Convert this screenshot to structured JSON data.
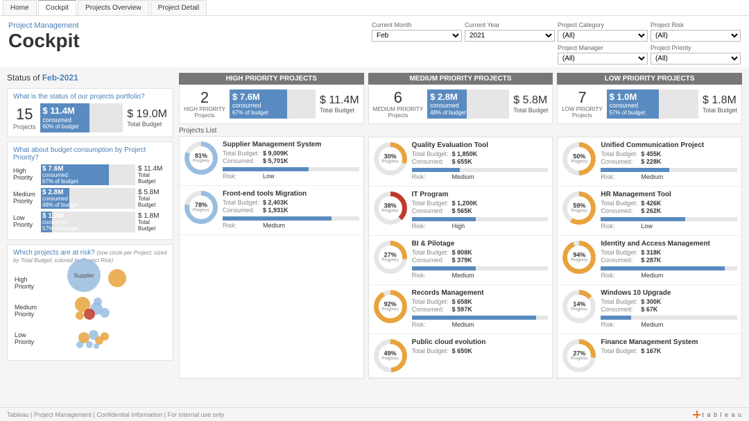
{
  "tabs": [
    "Home",
    "Cockpit",
    "Projects Overview",
    "Project Detail"
  ],
  "active_tab": 1,
  "header": {
    "sub": "Project Management",
    "main": "Cockpit"
  },
  "filters": [
    {
      "label": "Current Month",
      "value": "Feb"
    },
    {
      "label": "Current Year",
      "value": "2021"
    },
    {
      "label": "Project Category",
      "value": "(All)"
    },
    {
      "label": "Project Risk",
      "value": "(All)"
    },
    {
      "label": "Project Manager",
      "value": "(All)",
      "col": 2
    },
    {
      "label": "Project Priority",
      "value": "(All)",
      "col": 3
    }
  ],
  "status_prefix": "Status of",
  "status_date": "Feb-2021",
  "portfolio": {
    "q": "What is the status of our projects portfolio?",
    "count": "15",
    "count_label": "Projects",
    "consumed": "$ 11.4M",
    "consumed_label": "consumed",
    "pct": "60%",
    "pct_label": "of budget",
    "fill": 60,
    "total": "$ 19.0M",
    "total_label": "Total Budget"
  },
  "by_priority": {
    "q": "What about budget consumption by Project Priority?",
    "rows": [
      {
        "label": "High Priority",
        "amt": "$ 7.6M",
        "pct": "67%",
        "fill": 72,
        "total_amt": "$ 11.4M"
      },
      {
        "label": "Medium Priority",
        "amt": "$ 2.8M",
        "pct": "48%",
        "fill": 30,
        "total_amt": "$ 5.8M"
      },
      {
        "label": "Low Priority",
        "amt": "$ 1.0M",
        "pct": "57%",
        "fill": 12,
        "total_amt": "$ 1.8M"
      }
    ],
    "total_label": "Total Budget",
    "consumed_label": "consumed",
    "of_label": "of budget"
  },
  "risk": {
    "q": "Which projects are at risk?",
    "note": "(one circle per Project: sized by Total Budget, colored by Project Risk)",
    "rows": [
      "High Priority",
      "Medium Priority",
      "Low Priority"
    ],
    "supplier_label": "Supplier"
  },
  "columns": [
    {
      "title": "HIGH PRIORITY PROJECTS",
      "count": "2",
      "count_label": "HIGH PRIORITY Projects",
      "consumed": "$ 7.6M",
      "pct": "67%",
      "fill": 67,
      "total": "$ 11.4M",
      "list_title": "Projects List",
      "projects": [
        {
          "name": "Supplier Management System",
          "budget": "$ 9,009K",
          "consumed": "$ 5,701K",
          "progress": 81,
          "bar": 63,
          "risk": "Low",
          "color": "#99bde0"
        },
        {
          "name": "Front-end tools Migration",
          "budget": "$ 2,403K",
          "consumed": "$ 1,931K",
          "progress": 78,
          "bar": 80,
          "risk": "Medium",
          "color": "#99bde0"
        }
      ]
    },
    {
      "title": "MEDIUM PRIORITY PROJECTS",
      "count": "6",
      "count_label": "MEDIUM PRIORITY Projects",
      "consumed": "$ 2.8M",
      "pct": "48%",
      "fill": 48,
      "total": "$ 5.8M",
      "projects": [
        {
          "name": "Quality Evaluation Tool",
          "budget": "$ 1,850K",
          "consumed": "$ 655K",
          "progress": 30,
          "bar": 35,
          "risk": "Medium",
          "color": "#e8a33d"
        },
        {
          "name": "IT Program",
          "budget": "$ 1,200K",
          "consumed": "$ 565K",
          "progress": 38,
          "bar": 47,
          "risk": "High",
          "color": "#c0392b"
        },
        {
          "name": "BI & Pilotage",
          "budget": "$ 808K",
          "consumed": "$ 379K",
          "progress": 27,
          "bar": 47,
          "risk": "Medium",
          "color": "#e8a33d"
        },
        {
          "name": "Records Management",
          "budget": "$ 658K",
          "consumed": "$ 597K",
          "progress": 92,
          "bar": 91,
          "risk": "Medium",
          "color": "#e8a33d"
        },
        {
          "name": "Public cloud evolution",
          "budget": "$ 650K",
          "consumed": "",
          "progress": 49,
          "bar": 0,
          "risk": "",
          "color": "#e8a33d"
        }
      ]
    },
    {
      "title": "LOW PRIORITY PROJECTS",
      "count": "7",
      "count_label": "LOW PRIORITY Projects",
      "consumed": "$ 1.0M",
      "pct": "57%",
      "fill": 57,
      "total": "$ 1.8M",
      "projects": [
        {
          "name": "Unified Communication Project",
          "budget": "$ 455K",
          "consumed": "$ 228K",
          "progress": 50,
          "bar": 50,
          "risk": "Medium",
          "color": "#e8a33d"
        },
        {
          "name": "HR Management Tool",
          "budget": "$ 426K",
          "consumed": "$ 262K",
          "progress": 59,
          "bar": 62,
          "risk": "Low",
          "color": "#e8a33d"
        },
        {
          "name": "Identity and Access Management",
          "budget": "$ 318K",
          "consumed": "$ 287K",
          "progress": 94,
          "bar": 91,
          "risk": "Medium",
          "color": "#e8a33d"
        },
        {
          "name": "Windows 10 Upgrade",
          "budget": "$ 300K",
          "consumed": "$ 67K",
          "progress": 14,
          "bar": 22,
          "risk": "Medium",
          "color": "#e8a33d"
        },
        {
          "name": "Finance Management System",
          "budget": "$ 167K",
          "consumed": "",
          "progress": 27,
          "bar": 0,
          "risk": "",
          "color": "#e8a33d"
        }
      ]
    }
  ],
  "labels": {
    "total_budget": "Total Budget",
    "consumed": "consumed",
    "of_budget": "of budget",
    "progress": "Progress",
    "tbudget": "Total Budget:",
    "tconsumed": "Consumed:",
    "trisk": "Risk:"
  },
  "footer": "Tableau | Project Management | Confidential Information | For internal use only",
  "logo": "t a b l e a u"
}
